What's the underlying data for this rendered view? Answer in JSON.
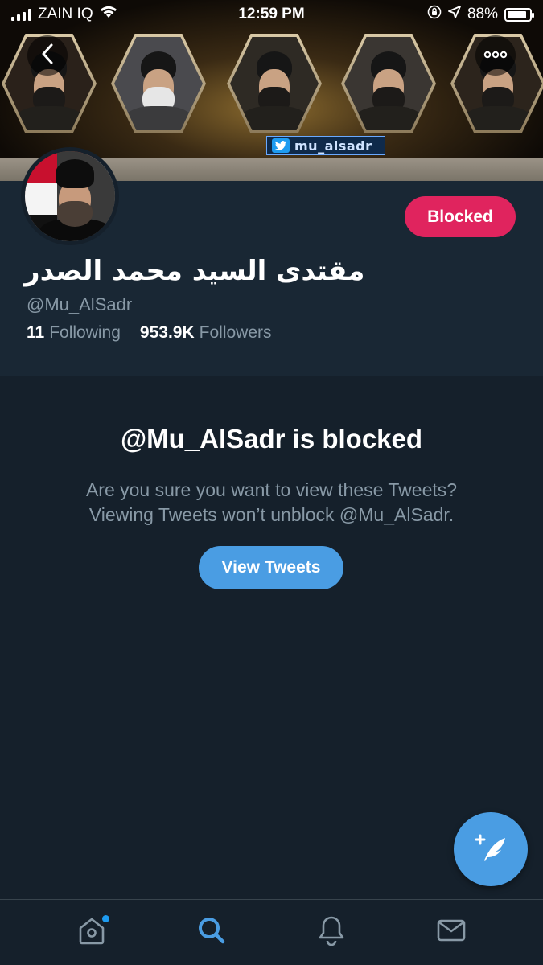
{
  "status_bar": {
    "carrier": "ZAIN IQ",
    "time": "12:59 PM",
    "battery": "88%",
    "battery_level": 0.88
  },
  "banner": {
    "tag_text": "mu_alsadr",
    "icons": [
      "back-chevron-icon",
      "more-options-icon"
    ]
  },
  "profile": {
    "blocked_label": "Blocked",
    "display_name": "مقتدى السيد محمد الصدر",
    "handle": "@Mu_AlSadr",
    "following_count": "11",
    "following_label": "Following",
    "followers_count": "953.9K",
    "followers_label": "Followers"
  },
  "notice": {
    "title": "@Mu_AlSadr is blocked",
    "message_line1": "Are you sure you want to view these Tweets?",
    "message_line2": "Viewing Tweets won’t unblock @Mu_AlSadr.",
    "button_label": "View Tweets"
  },
  "tab_bar": {
    "tabs": [
      "home-icon",
      "search-icon",
      "notifications-icon",
      "messages-icon"
    ],
    "active_tab": "search-icon"
  },
  "colors": {
    "background": "#15202b",
    "profile_bg": "#192734",
    "accent": "#4a9de3",
    "blocked": "#e0245e",
    "secondary_text": "#8899a6"
  }
}
